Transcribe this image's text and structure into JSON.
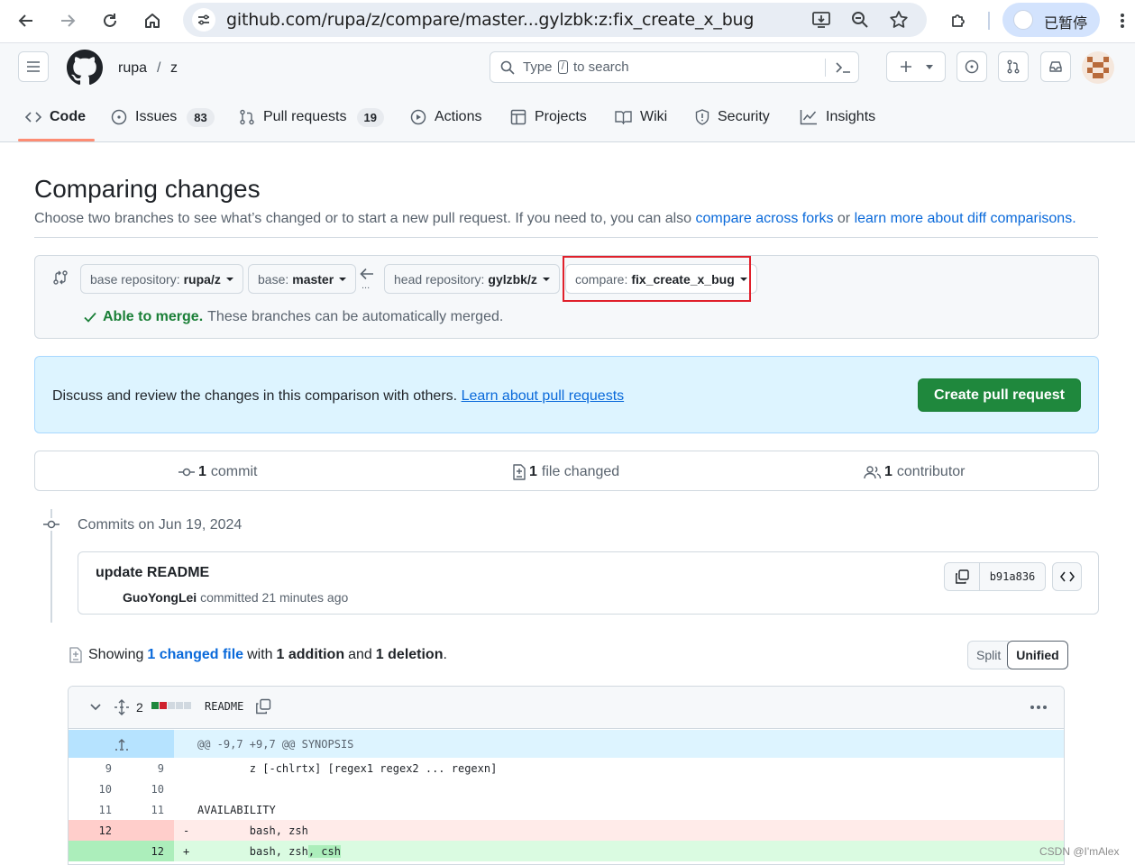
{
  "browser": {
    "url": "github.com/rupa/z/compare/master...gylzbk:z:fix_create_x_bug",
    "profile_label": "已暂停"
  },
  "header": {
    "owner": "rupa",
    "separator": "/",
    "repo": "z",
    "search_prefix": "Type",
    "search_key": "/",
    "search_suffix": "to search"
  },
  "tabs": [
    {
      "label": "Code",
      "counter": ""
    },
    {
      "label": "Issues",
      "counter": "83"
    },
    {
      "label": "Pull requests",
      "counter": "19"
    },
    {
      "label": "Actions",
      "counter": ""
    },
    {
      "label": "Projects",
      "counter": ""
    },
    {
      "label": "Wiki",
      "counter": ""
    },
    {
      "label": "Security",
      "counter": ""
    },
    {
      "label": "Insights",
      "counter": ""
    }
  ],
  "compare": {
    "title": "Comparing changes",
    "desc_text": "Choose two branches to see what’s changed or to start a new pull request. If you need to, you can also",
    "desc_link1": "compare across forks",
    "desc_or": "or",
    "desc_link2": "learn more about diff comparisons.",
    "base_repo_label": "base repository:",
    "base_repo_value": "rupa/z",
    "base_label": "base:",
    "base_value": "master",
    "head_repo_label": "head repository:",
    "head_repo_value": "gylzbk/z",
    "compare_label": "compare:",
    "compare_value": "fix_create_x_bug",
    "dots": "...",
    "merge_ok": "Able to merge.",
    "merge_text": "These branches can be automatically merged."
  },
  "flash": {
    "text": "Discuss and review the changes in this comparison with others.",
    "link": "Learn about pull requests",
    "button": "Create pull request"
  },
  "summary": {
    "commits_num": "1",
    "commits_label": "commit",
    "files_num": "1",
    "files_label": "file changed",
    "contributors_num": "1",
    "contributors_label": "contributor"
  },
  "commits": {
    "heading": "Commits on Jun 19, 2024",
    "message": "update README",
    "author": "GuoYongLei",
    "meta": "committed 21 minutes ago",
    "sha": "b91a836"
  },
  "diff": {
    "showing": "Showing",
    "changed_link": "1 changed file",
    "with": "with",
    "additions": "1 addition",
    "and": "and",
    "deletions": "1 deletion",
    "period": ".",
    "split": "Split",
    "unified": "Unified",
    "file_changes": "2",
    "file_name": "README",
    "diffstat": [
      "add",
      "del",
      "neutral",
      "neutral",
      "neutral"
    ],
    "hunk": "@@ -9,7 +9,7 @@ SYNOPSIS",
    "lines": [
      {
        "old": "9",
        "new": "9",
        "sign": " ",
        "text": "        z [-chlrtx] [regex1 regex2 ... regexn]",
        "type": "ctx"
      },
      {
        "old": "10",
        "new": "10",
        "sign": " ",
        "text": "",
        "type": "ctx"
      },
      {
        "old": "11",
        "new": "11",
        "sign": " ",
        "text": "AVAILABILITY",
        "type": "ctx"
      },
      {
        "old": "12",
        "new": "",
        "sign": "-",
        "text": "        bash, zsh",
        "type": "del"
      },
      {
        "old": "",
        "new": "12",
        "sign": "+",
        "text": "        bash, zsh",
        "extra": ", csh",
        "type": "add"
      }
    ]
  },
  "colors": {
    "add_bg": "#dafbe1",
    "add_gutter": "#aceebb",
    "del_bg": "#ffebe9",
    "del_gutter": "#ffcecb",
    "hunk_bg": "#ddf4ff",
    "hunk_gutter": "#b6e3ff",
    "primary_btn": "#1f883d",
    "link": "#0969da",
    "highlight_box": "#e0202b"
  },
  "watermark": "CSDN @I'mAlex"
}
